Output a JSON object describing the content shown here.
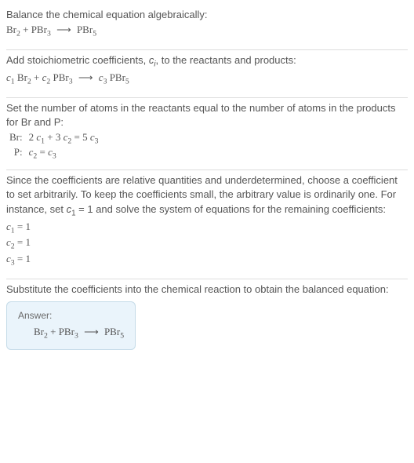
{
  "section1": {
    "title": "Balance the chemical equation algebraically:",
    "eq_left1": "Br",
    "eq_sub1": "2",
    "eq_plus": " + PBr",
    "eq_sub2": "3",
    "arrow": "⟶",
    "eq_right": "PBr",
    "eq_sub3": "5"
  },
  "section2": {
    "title": "Add stoichiometric coefficients, ",
    "ci": "c",
    "ci_sub": "i",
    "title_end": ", to the reactants and products:",
    "c1": "c",
    "c1s": "1",
    "br2": " Br",
    "br2s": "2",
    "plus": " + ",
    "c2": "c",
    "c2s": "2",
    "pbr3": " PBr",
    "pbr3s": "3",
    "arrow": "⟶",
    "c3": "c",
    "c3s": "3",
    "pbr5": " PBr",
    "pbr5s": "5"
  },
  "section3": {
    "title": "Set the number of atoms in the reactants equal to the number of atoms in the products for Br and P:",
    "row1_label": "Br:",
    "row1_eq_a": "2 ",
    "row1_c1": "c",
    "row1_c1s": "1",
    "row1_eq_b": " + 3 ",
    "row1_c2": "c",
    "row1_c2s": "2",
    "row1_eq_c": " = 5 ",
    "row1_c3": "c",
    "row1_c3s": "3",
    "row2_label": "P:",
    "row2_c2": "c",
    "row2_c2s": "2",
    "row2_eq": " = ",
    "row2_c3": "c",
    "row2_c3s": "3"
  },
  "section4": {
    "title": "Since the coefficients are relative quantities and underdetermined, choose a coefficient to set arbitrarily. To keep the coefficients small, the arbitrary value is ordinarily one. For instance, set ",
    "c1": "c",
    "c1s": "1",
    "title_mid": " = 1 and solve the system of equations for the remaining coefficients:",
    "line1_c": "c",
    "line1_s": "1",
    "line1_v": " = 1",
    "line2_c": "c",
    "line2_s": "2",
    "line2_v": " = 1",
    "line3_c": "c",
    "line3_s": "3",
    "line3_v": " = 1"
  },
  "section5": {
    "title": "Substitute the coefficients into the chemical reaction to obtain the balanced equation:",
    "answer_label": "Answer:",
    "br2": "Br",
    "br2s": "2",
    "plus": " + PBr",
    "pbr3s": "3",
    "arrow": "⟶",
    "pbr5": "PBr",
    "pbr5s": "5"
  }
}
